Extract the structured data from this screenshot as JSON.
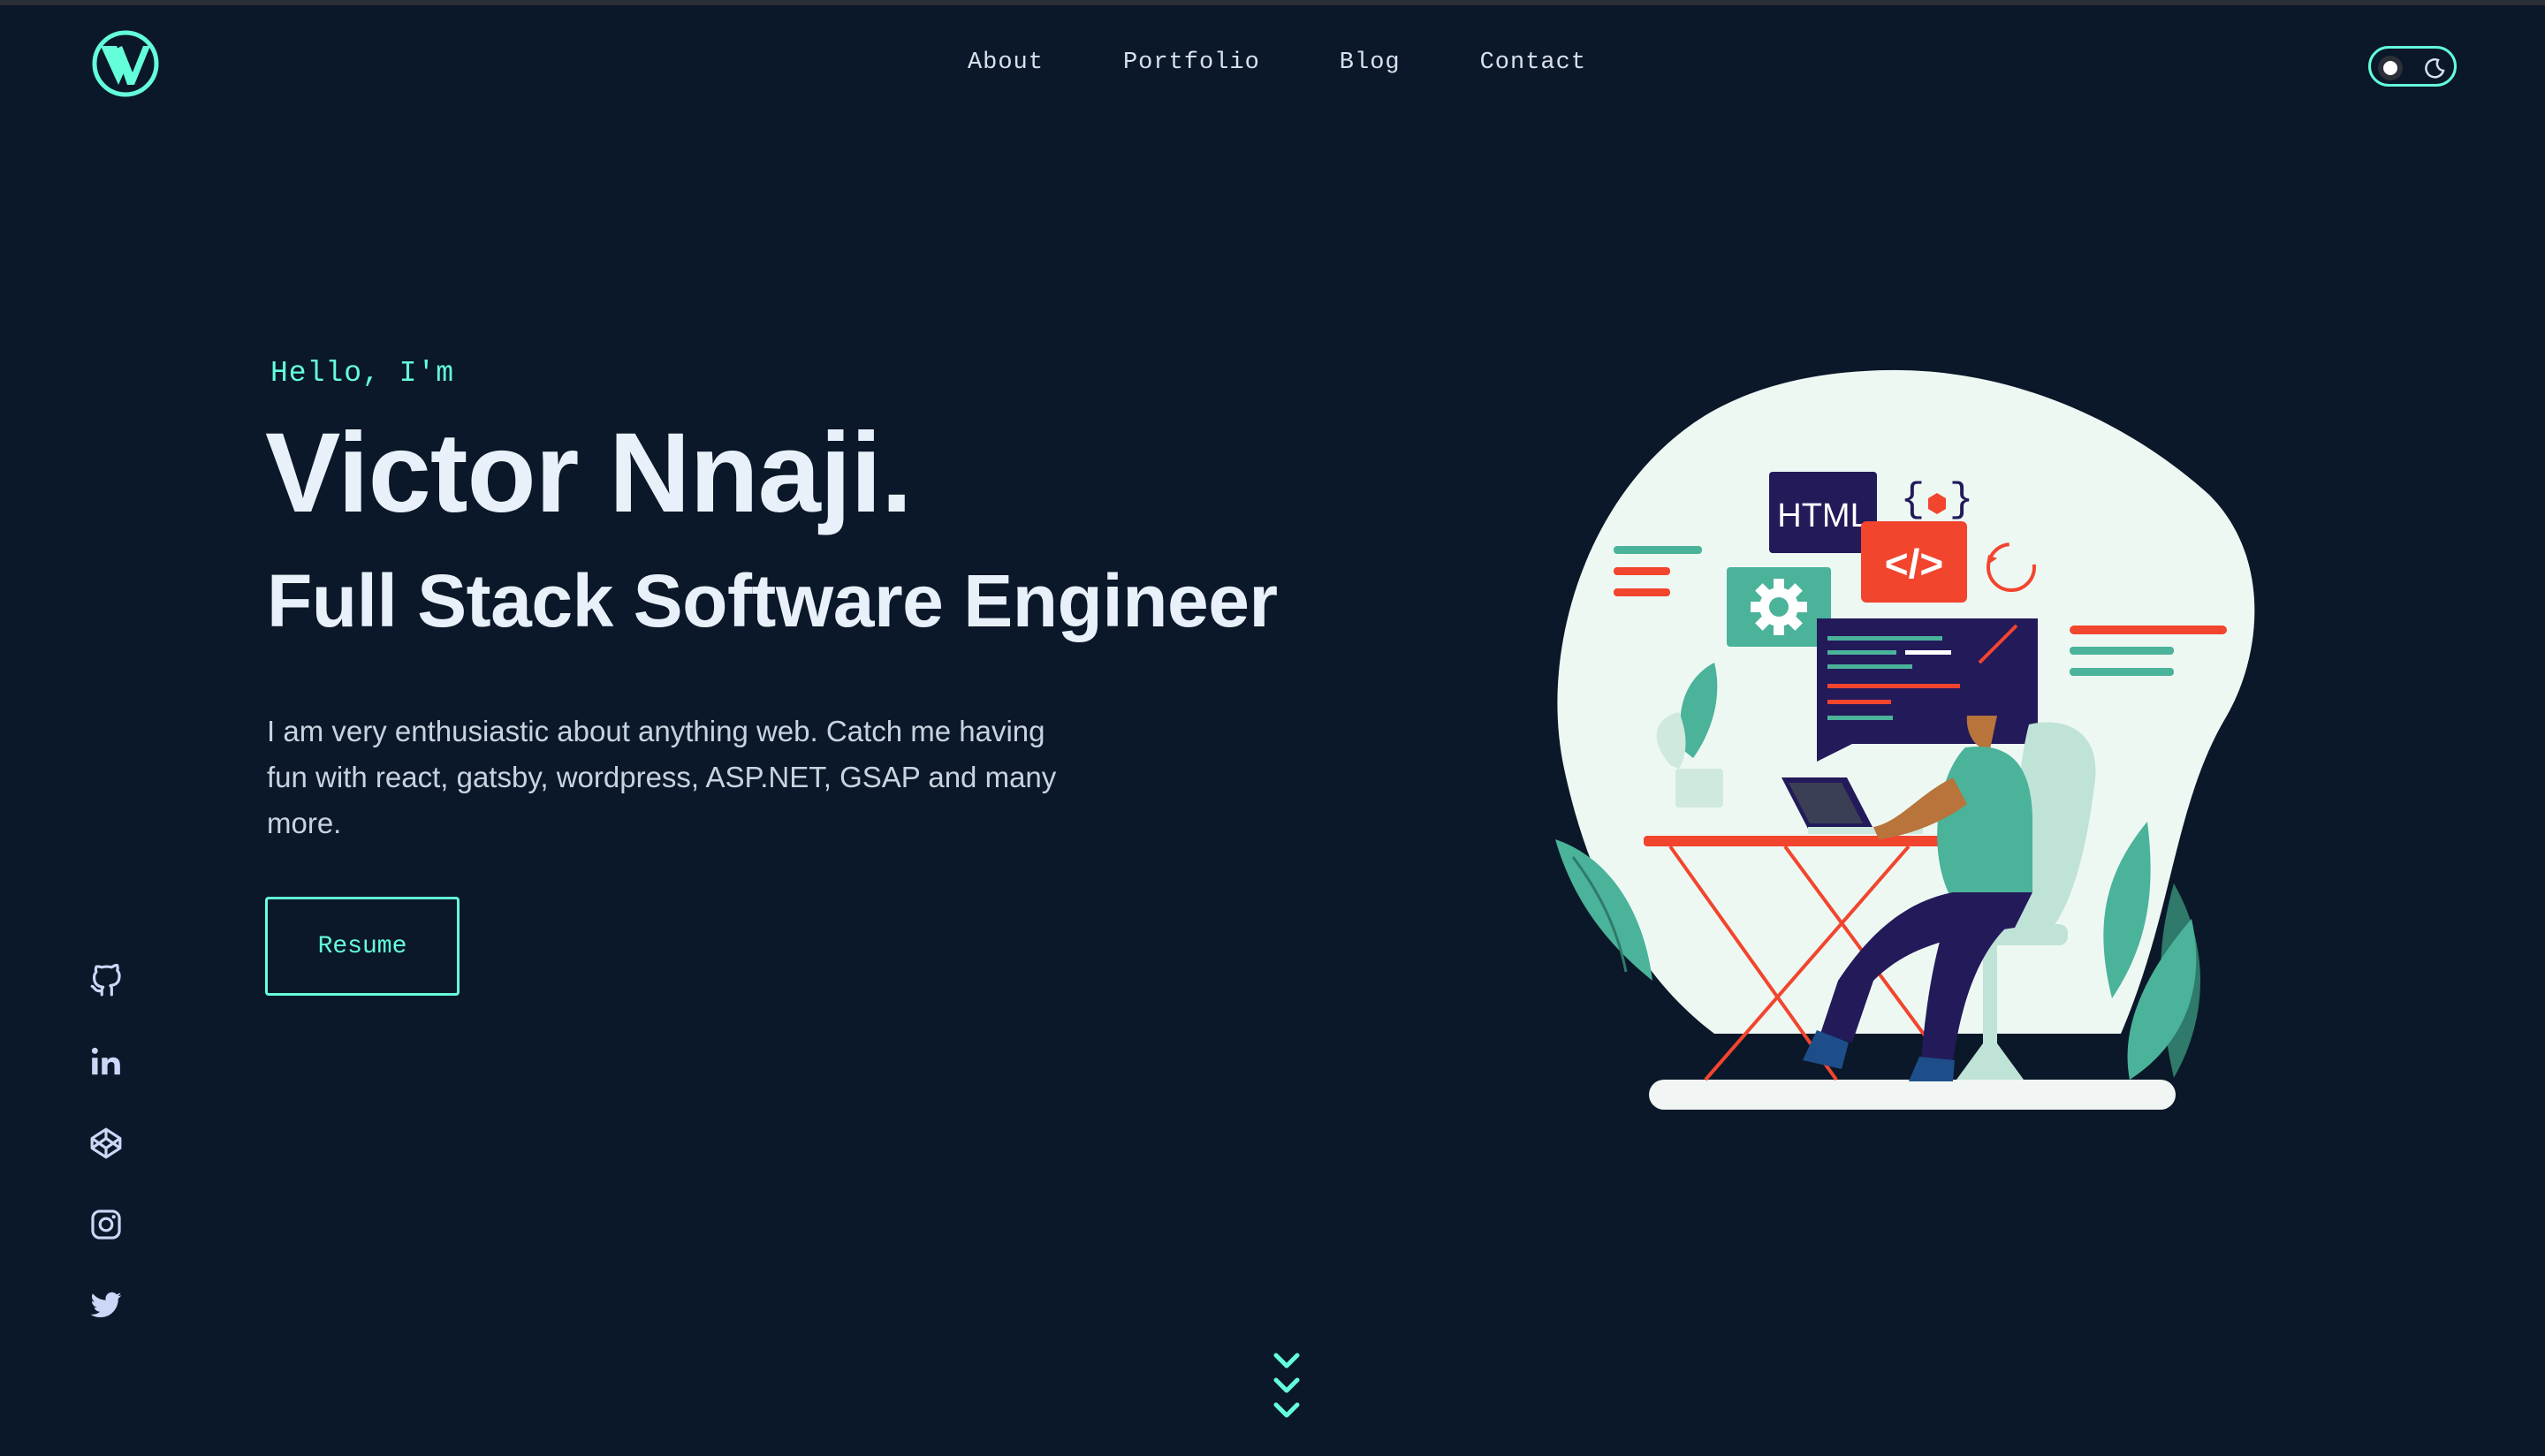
{
  "header": {
    "logo_icon": "vn-monogram-logo",
    "nav": [
      {
        "label": "About"
      },
      {
        "label": "Portfolio"
      },
      {
        "label": "Blog"
      },
      {
        "label": "Contact"
      }
    ],
    "theme_toggle": {
      "icons": [
        "sun-toggle-icon",
        "moon-icon"
      ]
    }
  },
  "hero": {
    "greeting": "Hello, I'm",
    "name": "Victor Nnaji.",
    "role": "Full Stack Software Engineer",
    "bio": "I am very enthusiastic about anything web. Catch me having fun with react, gatsby, wordpress, ASP.NET, GSAP and many more.",
    "resume_label": "Resume",
    "illustration_text": {
      "html_tag": "HTML",
      "code_tag": "</>",
      "braces": "{ }"
    }
  },
  "social": [
    "github-icon",
    "linkedin-icon",
    "codepen-icon",
    "instagram-icon",
    "twitter-icon"
  ],
  "scroll_icon": "chevrons-down-icon",
  "colors": {
    "bg": "#0b1829",
    "accent": "#64ffda",
    "text": "#e8f1fa",
    "red": "#f2452e",
    "navy": "#231a5a"
  }
}
